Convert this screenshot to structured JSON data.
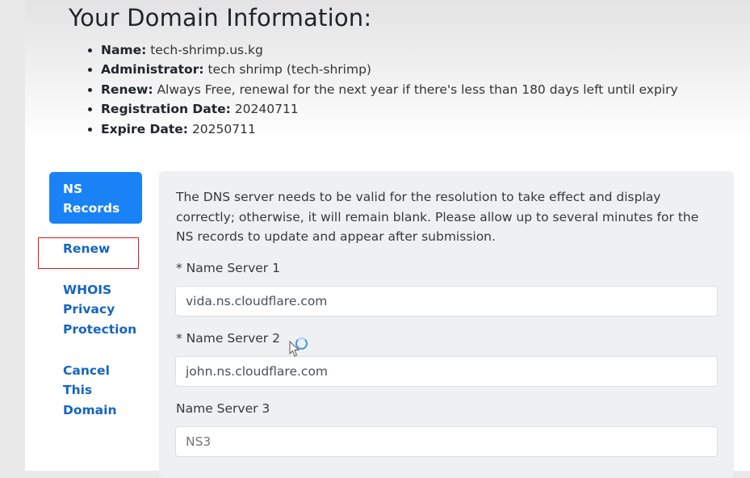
{
  "heading": "Your Domain Information:",
  "info": [
    {
      "key": "Name:",
      "value": "tech-shrimp.us.kg"
    },
    {
      "key": "Administrator:",
      "value": "tech shrimp (tech-shrimp)"
    },
    {
      "key": "Renew:",
      "value": "Always Free, renewal for the next year if there's less than 180 days left until expiry"
    },
    {
      "key": "Registration Date:",
      "value": "20240711"
    },
    {
      "key": "Expire Date:",
      "value": "20250711"
    }
  ],
  "nav": {
    "ns_records": {
      "line1": "NS",
      "line2": "Records"
    },
    "renew": "Renew",
    "whois": {
      "line1": "WHOIS",
      "line2": "Privacy",
      "line3": "Protection"
    },
    "cancel": {
      "line1": "Cancel",
      "line2": "This",
      "line3": "Domain"
    }
  },
  "form": {
    "description": "The DNS server needs to be valid for the resolution to take effect and display correctly; otherwise, it will remain blank. Please allow up to several minutes for the NS records to update and appear after submission.",
    "ns1": {
      "label": "* Name Server 1",
      "value": "vida.ns.cloudflare.com"
    },
    "ns2": {
      "label": "* Name Server 2",
      "value": "john.ns.cloudflare.com"
    },
    "ns3": {
      "label": "Name Server 3",
      "placeholder": "NS3"
    }
  },
  "colors": {
    "accent": "#1a82f7",
    "link": "#1565c0",
    "highlight": "#e01818"
  }
}
